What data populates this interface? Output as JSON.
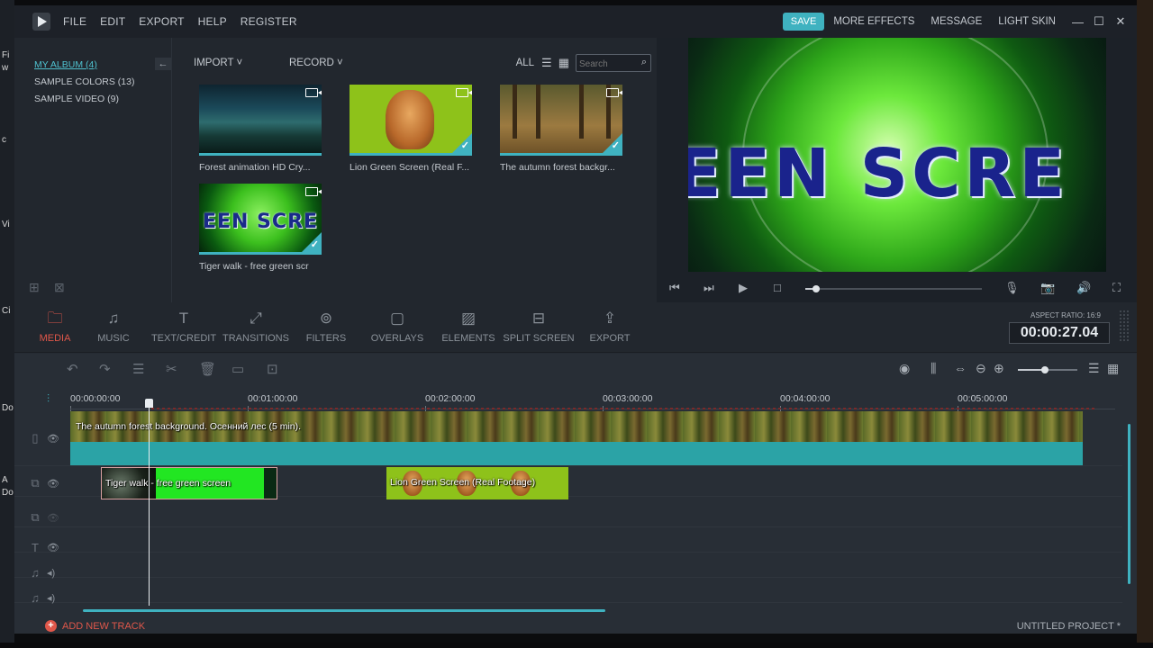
{
  "desktop": {
    "left_texts": [
      "Fi",
      "w",
      "c",
      "Vi",
      "Ci",
      "Do",
      "Do",
      "A"
    ]
  },
  "app": {
    "menu": [
      "FILE",
      "EDIT",
      "EXPORT",
      "HELP",
      "REGISTER"
    ],
    "save": "SAVE",
    "top_links": [
      "MORE EFFECTS",
      "MESSAGE",
      "LIGHT SKIN"
    ],
    "window_controls": [
      "—",
      "☐",
      "✕"
    ]
  },
  "library": {
    "albums": [
      "MY ALBUM (4)",
      "SAMPLE COLORS (13)",
      "SAMPLE VIDEO (9)"
    ],
    "collapse_icon": "←",
    "import": "IMPORT ˅",
    "record": "RECORD ˅",
    "filter": "ALL",
    "search_placeholder": "Search",
    "search_icon": "⌕",
    "media": [
      {
        "title": "Forest animation HD Cry...",
        "checked": false
      },
      {
        "title": "Lion Green Screen (Real F...",
        "checked": true
      },
      {
        "title": "The autumn forest backgr...",
        "checked": true
      },
      {
        "title": "Tiger walk - free green scr",
        "checked": true,
        "overlay_text": "EEN SCRE"
      }
    ]
  },
  "preview": {
    "screen_text": "EEN SCRE",
    "progress": 0.06
  },
  "toolbar": {
    "tools": [
      "MEDIA",
      "MUSIC",
      "TEXT/CREDIT",
      "TRANSITIONS",
      "FILTERS",
      "OVERLAYS",
      "ELEMENTS",
      "SPLIT SCREEN",
      "EXPORT"
    ],
    "active_tool": "MEDIA",
    "aspect_ratio": "ASPECT RATIO: 16:9",
    "timecode": "00:00:27.04"
  },
  "timeline": {
    "ruler": [
      "00:00:00:00",
      "00:01:00:00",
      "00:02:00:00",
      "00:03:00:00",
      "00:04:00:00",
      "00:05:00:00"
    ],
    "main_clip": "The autumn forest background. Осенний лес (5 min).",
    "pip_clips": [
      "Tiger walk - free green screen",
      "Lion Green Screen (Real Footage)"
    ],
    "zoom": 0.45,
    "add_track": "ADD NEW TRACK",
    "project_name": "UNTITLED PROJECT *"
  },
  "colors": {
    "accent": "#3fb2c0",
    "active": "#e0574a",
    "green_screen": "#22e622"
  }
}
